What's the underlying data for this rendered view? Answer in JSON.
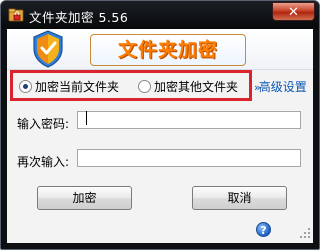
{
  "window": {
    "title": "文件夹加密 5.56",
    "close_glyph": "✕"
  },
  "banner": {
    "title": "文件夹加密"
  },
  "mode": {
    "options": [
      {
        "label": "加密当前文件夹",
        "selected": true
      },
      {
        "label": "加密其他文件夹",
        "selected": false
      }
    ],
    "advanced_arrows": "»",
    "advanced_label": "高级设置"
  },
  "form": {
    "password_label": "输入密码:",
    "password_value": "",
    "confirm_label": "再次输入:",
    "confirm_value": ""
  },
  "buttons": {
    "encrypt_label": "加密",
    "cancel_label": "取消"
  },
  "help": {
    "glyph": "?"
  },
  "colors": {
    "highlight_border": "#d9232d",
    "banner_text": "#ff7d00",
    "link": "#0b57b7"
  }
}
